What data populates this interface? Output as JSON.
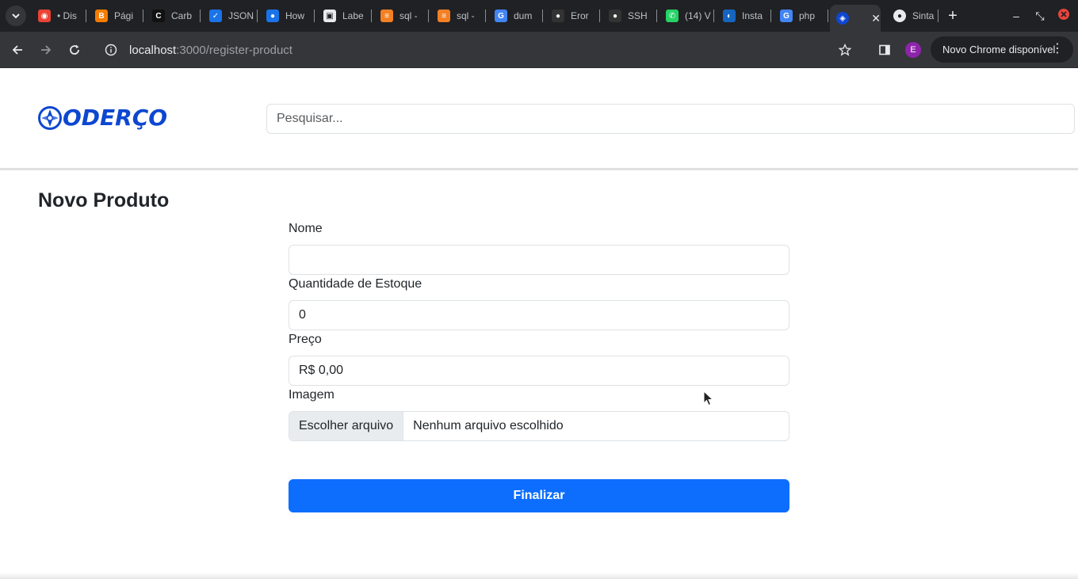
{
  "browser": {
    "tabs": [
      {
        "title": "• Dis",
        "icon": "chrome-icon",
        "color": "#ea4335"
      },
      {
        "title": "Pági",
        "icon": "blogger-icon",
        "color": "#f57c00"
      },
      {
        "title": "Carb",
        "icon": "carbon-icon",
        "color": "#111111"
      },
      {
        "title": "JSON",
        "icon": "check-icon",
        "color": "#1a73e8"
      },
      {
        "title": "How",
        "icon": "dot-icon",
        "color": "#1a73e8"
      },
      {
        "title": "Labe",
        "icon": "box-icon",
        "color": "#e8eaed"
      },
      {
        "title": "sql -",
        "icon": "stackoverflow-icon",
        "color": "#f48024"
      },
      {
        "title": "sql -",
        "icon": "stackoverflow-icon",
        "color": "#f48024"
      },
      {
        "title": "dum",
        "icon": "google-icon",
        "color": "#4285f4"
      },
      {
        "title": "Eror",
        "icon": "github-icon",
        "color": "#333333"
      },
      {
        "title": "SSH",
        "icon": "github-icon",
        "color": "#333333"
      },
      {
        "title": "(14) V",
        "icon": "whatsapp-icon",
        "color": "#25d366"
      },
      {
        "title": "Insta",
        "icon": "insta-icon",
        "color": "#1565c0"
      },
      {
        "title": "php",
        "icon": "google-icon",
        "color": "#4285f4"
      }
    ],
    "active_tab": {
      "title": "",
      "icon": "oderco-favicon"
    },
    "last_tab": {
      "title": "Sinta",
      "icon": "github-icon"
    },
    "url_host": "localhost",
    "url_path": ":3000/register-product",
    "profile_initial": "E",
    "update_label": "Novo Chrome disponível"
  },
  "header": {
    "logo_text": "ODERÇO",
    "search_placeholder": "Pesquisar..."
  },
  "page": {
    "title": "Novo Produto"
  },
  "form": {
    "name_label": "Nome",
    "name_value": "",
    "stock_label": "Quantidade de Estoque",
    "stock_value": "0",
    "price_label": "Preço",
    "price_value": "R$ 0,00",
    "image_label": "Imagem",
    "file_button": "Escolher arquivo",
    "file_status": "Nenhum arquivo escolhido",
    "submit_label": "Finalizar"
  },
  "colors": {
    "brand": "#0d47d1",
    "primary": "#0d6efd"
  }
}
